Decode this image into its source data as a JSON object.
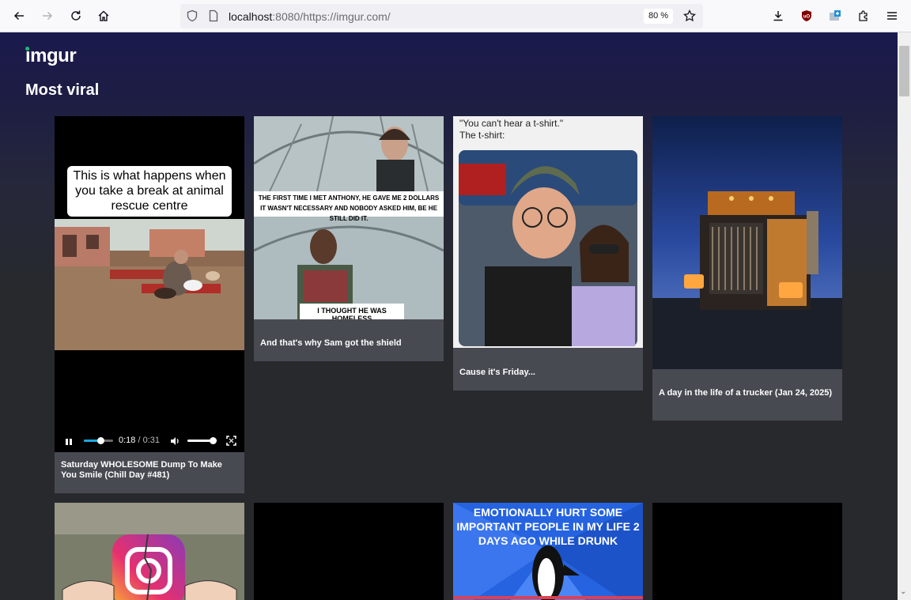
{
  "browser": {
    "url_host": "localhost",
    "url_rest": ":8080/https://imgur.com/",
    "zoom": "80 %"
  },
  "site": {
    "logo": "imgur",
    "section_title": "Most viral"
  },
  "posts": [
    {
      "title": "Saturday WHOLESOME Dump To Make You Smile (Chill Day #481)",
      "overlay_text": "This is what happens when you take a break at animal rescue centre",
      "video": {
        "current": "0:18",
        "separator": "/",
        "duration": "0:31",
        "progress": 0.58,
        "volume": 1.0
      }
    },
    {
      "title": "And that's why Sam got the shield",
      "meme_top": "THE FIRST TIME I MET ANTHONY, HE GAVE ME 2 DOLLARS",
      "meme_top2": "IT WASN'T NECESSARY AND NOBODY ASKED HIM, BE HE STILL DID IT.",
      "meme_bottom": "I THOUGHT HE WAS HOMELESS"
    },
    {
      "title": "Cause it's Friday...",
      "quote_line1": "\"You can't hear a t-shirt.\"",
      "quote_line2": "The t-shirt:"
    },
    {
      "title": "A day in the life of a trucker (Jan 24, 2025)"
    },
    {
      "title": ""
    },
    {
      "title": ""
    },
    {
      "title": "",
      "meme_text_1": "EMOTIONALLY HURT SOME",
      "meme_text_2": "IMPORTANT PEOPLE IN MY LIFE 2",
      "meme_text_3": "DAYS AGO WHILE DRUNK"
    },
    {
      "title": ""
    }
  ],
  "colors": {
    "accent_green": "#1bb76e",
    "card_bg": "#474a51",
    "page_top": "#1b1a4e",
    "page_bottom": "#27292d",
    "video_accent": "#1ea7e1"
  }
}
